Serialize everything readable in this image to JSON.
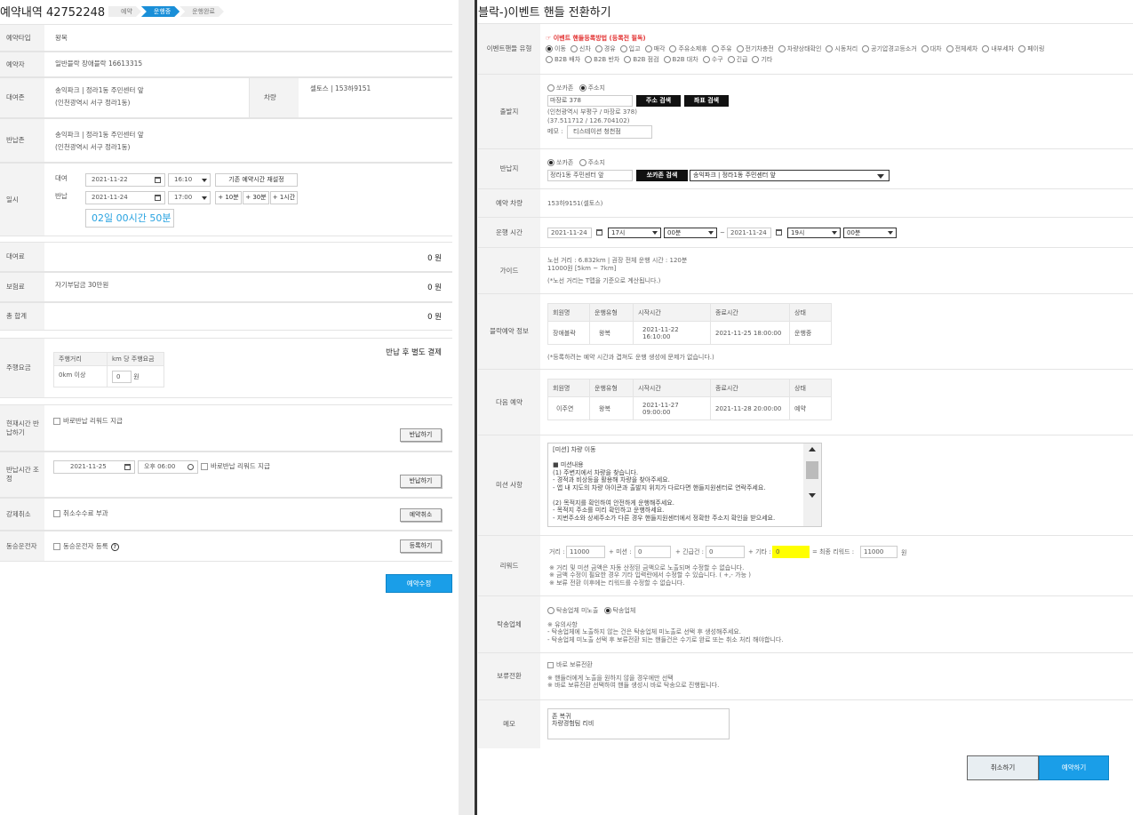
{
  "left": {
    "title": "예약내역 42752248",
    "steps": [
      "예약",
      "운행중",
      "운행완료"
    ],
    "rows": {
      "type_label": "예약타입",
      "type_value": "왕복",
      "booker_label": "예약자",
      "booker_value": "일반블락 장애블락 16613315",
      "rent_zone_label": "대여존",
      "rent_zone_value": "송익파크 | 정라1동 주민센터 앞",
      "rent_zone_addr": "(인천광역시 서구 정라1동)",
      "car_label": "차량",
      "car_value": "셀토스 | 153하9151",
      "return_zone_label": "반납존",
      "return_zone_value": "송익파크 | 정라1동 주민센터 앞",
      "return_zone_addr": "(인천광역시 서구 정라1동)",
      "datetime_label": "일시",
      "rent_label": "대여",
      "rent_date": "2021-11-22",
      "rent_time": "16:10",
      "reset_button": "기존 예약시간 재설정",
      "return_label": "반납",
      "return_date": "2021-11-24",
      "return_time": "17:00",
      "add10": "+ 10분",
      "add30": "+ 30분",
      "add1h": "+ 1시간",
      "duration": "02일 00시간 50분",
      "fee_label": "대여료",
      "fee_value": "0 원",
      "insurance_label": "보험료",
      "insurance_value": "자기부담금 30만원",
      "insurance_amount": "0 원",
      "total_label": "총 합계",
      "total_value": "0 원",
      "drive_fee_label": "주행요금",
      "drive_fee_note": "반납 후 별도 결제",
      "drive_col1": "주행거리",
      "drive_col2": "km 당 주행요금",
      "drive_dist": "0km 이상",
      "drive_rate": "0",
      "drive_unit": "원",
      "now_return_label": "현재시간 반납하기",
      "reward_check": "바로반납 리워드 지급",
      "return_button": "반납하기",
      "adjust_label": "반납시간 조정",
      "adjust_date": "2021-11-25",
      "adjust_time": "오후 06:00",
      "reward_check2": "바로반납 리워드 지급",
      "return_button2": "반납하기",
      "force_cancel_label": "강제취소",
      "cancel_fee_check": "취소수수료 부과",
      "cancel_button": "예약취소",
      "co_driver_label": "동승운전자",
      "co_driver_check": "동승운전자 등록",
      "register_button": "등록하기"
    },
    "modify_button": "예약수정"
  },
  "right": {
    "title": "블락-)이벤트 핸들 전환하기",
    "event_type_label": "이벤트핸들 유형",
    "event_warning": "이벤트 핸들등록방법 (등록전 필독)",
    "event_types_row1": [
      "이동",
      "신차",
      "경유",
      "입고",
      "매각",
      "주유소제휴",
      "주유",
      "전기차충전",
      "차량상태확인",
      "시동처리",
      "공기압경고등소거",
      "대차",
      "전체세차",
      "내부세차",
      "페이링"
    ],
    "event_types_row2": [
      "B2B 배차",
      "B2B 반차",
      "B2B 점검",
      "B2B 대차",
      "수구",
      "긴급",
      "기타"
    ],
    "start_label": "출발지",
    "start_opt1": "쏘카존",
    "start_opt2": "주소지",
    "start_input": "마장로 378",
    "addr_search": "주소 검색",
    "coord_search": "좌표 검색",
    "start_addr_line": "(인천광역시 부평구 / 마장로 378)",
    "start_coord_line": "(37.511712 / 126.704102)",
    "memo_prefix": "메모 :",
    "start_memo": "티스테이션 청천점",
    "return_label": "반납지",
    "return_opt1": "쏘카존",
    "return_opt2": "주소지",
    "return_input": "정라1동 주민센터 앞",
    "zone_search": "쏘카존 검색",
    "zone_select": "송익파크 | 정라1동 주민센터 앞",
    "car_label": "예약 차량",
    "car_value": "153하9151(셀토스)",
    "time_label": "운행 시간",
    "from_date": "2021-11-24",
    "from_hour": "17시",
    "from_min": "00분",
    "to_date": "2021-11-24",
    "to_hour": "19시",
    "to_min": "00분",
    "tilde": "~",
    "guide_label": "가이드",
    "guide_line1": "노선 거리 : 6.832km | 권장 전체 운행 시간 : 120분",
    "guide_line2": "11000원 [5km ~ 7km]",
    "guide_line3": "(*노선 거리는 T맵을 기준으로 계산됩니다.)",
    "block_label": "블락예약 정보",
    "table_headers": [
      "회원명",
      "운행유형",
      "시작시간",
      "종료시간",
      "상태"
    ],
    "block_row": [
      "장애블락",
      "왕복",
      "2021-11-22 16:10:00",
      "2021-11-25 18:00:00",
      "운행중"
    ],
    "block_note": "(*등록하려는 예약 시간과 겹쳐도 운행 생성에 문제가 없습니다.)",
    "next_label": "다음 예약",
    "next_row": [
      "이주연",
      "왕복",
      "2021-11-27 09:00:00",
      "2021-11-28 20:00:00",
      "예약"
    ],
    "mission_label": "미션 사항",
    "mission_text": "[미션] 차량 이동\n\n■ 미션내용\n(1) 주변지에서 차량을 찾습니다.\n- 경적과 비상등을 활용해 차량을 찾아주세요.\n- 앱 내 지도의 차량 아이콘과 출발지 위치가 다르다면 핸들지원센터로 연락주세요.\n\n(2) 목적지를 확인하여 안전하게 운행해주세요.\n- 목적지 주소를 미리 확인하고 운행하세요.\n- 지번주소와 상세주소가 다른 경우 핸들지원센터에서 정확한 주소지 확인을 받으세요.",
    "reward_label": "리워드",
    "dist_prefix": "거리 :",
    "dist_val": "11000",
    "mission_prefix": "+ 미션 :",
    "mission_val": "0",
    "urgent_prefix": "+ 긴급건 :",
    "urgent_val": "0",
    "etc_prefix": "+ 기타 :",
    "etc_val": "0",
    "final_prefix": "= 최종 리워드 :",
    "final_val": "11000",
    "won": "원",
    "reward_note1": "※ 거리 및 미션 금액은 자동 산정된 금액으로 노출되며 수정할 수 없습니다.",
    "reward_note2": "※ 금액 수정이 필요한 경우 기타 입력란에서 수정할 수 있습니다. ( +,- 가능 )",
    "reward_note3": "※ 보류 전환 이후에는 리워드를 수정할 수 없습니다.",
    "carrier_label": "탁송업체",
    "carrier_opt1": "탁송업체 미노출",
    "carrier_opt2": "탁송업체",
    "carrier_note1": "※ 유의사항",
    "carrier_note2": "- 탁송업체에 노출하지 않는 건은 탁송업체 미노출로 선택 후 생성해주세요.",
    "carrier_note3": "- 탁송업체 미노출 선택 후 보류전환 되는 핸들건은 수기로 완료 또는 취소 처리 해야합니다.",
    "hold_label": "보류전환",
    "hold_check": "바로 보류전환",
    "hold_note1": "※ 핸들러에게 노출을 원하지 않을 경우에만 선택",
    "hold_note2": "※ 바로 보류전환 선택하여 핸들 생성시 바로 탁송으로 진행됩니다.",
    "memo_label": "메모",
    "memo_text": "존 복귀\n차량경험팀 리비",
    "cancel_button": "취소하기",
    "book_button": "예약하기"
  },
  "colors": {
    "accent": "#1a9ee8",
    "link_blue": "#27a2e0",
    "warn_red": "#e23030",
    "highlight_yellow": "#ffff00"
  }
}
